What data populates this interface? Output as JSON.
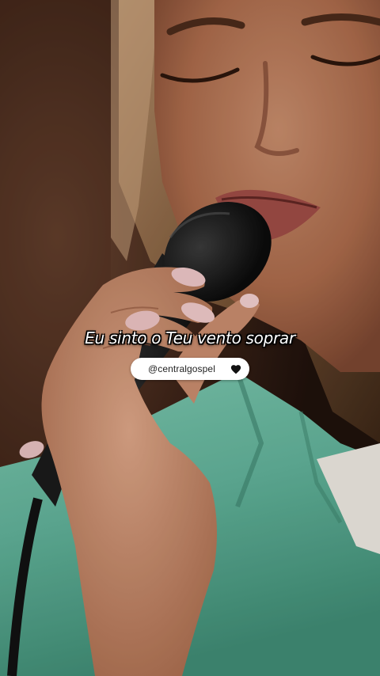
{
  "video": {
    "subtitle": "Eu sinto o Teu vento soprar"
  },
  "watermark": {
    "handle": "@centralgospel",
    "icon": "heart-icon"
  },
  "colors": {
    "subtitle_text": "#ffffff",
    "subtitle_outline": "#000000",
    "pill_background": "#ffffff",
    "pill_text": "#222222",
    "shirt": "#5fae96"
  }
}
